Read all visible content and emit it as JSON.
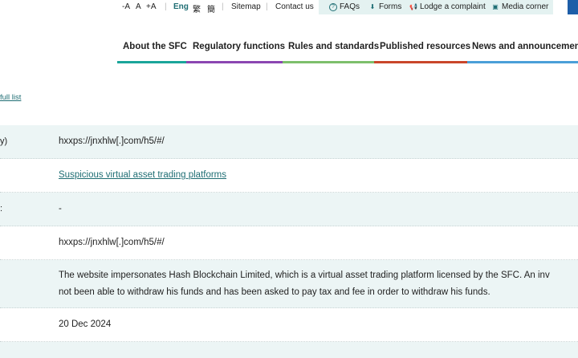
{
  "topbar": {
    "font_sizes": [
      "-A",
      "A",
      "+A"
    ],
    "languages": [
      "Eng",
      "繁",
      "簡"
    ],
    "links": [
      "Sitemap",
      "Contact us"
    ]
  },
  "quick_links": [
    {
      "label": "FAQs",
      "icon": "question-circle-icon"
    },
    {
      "label": "Forms",
      "icon": "download-icon"
    },
    {
      "label": "Lodge a complaint",
      "icon": "megaphone-icon"
    },
    {
      "label": "Media corner",
      "icon": "image-icon"
    }
  ],
  "nav": [
    {
      "label": "About the SFC",
      "color": "#1aa59a"
    },
    {
      "label": "Regulatory functions",
      "color": "#8b46b2"
    },
    {
      "label": "Rules and standards",
      "color": "#7dbf6b"
    },
    {
      "label": "Published resources",
      "color": "#c9462a"
    },
    {
      "label": "News and announcements",
      "color": "#4a9fd8"
    }
  ],
  "back_link": "full list",
  "rows": [
    {
      "label": "y)",
      "value": "hxxps://jnxhlw[.]com/h5/#/"
    },
    {
      "label": "",
      "value": "Suspicious virtual asset trading platforms",
      "link": true
    },
    {
      "label": ":",
      "value": "-"
    },
    {
      "label": "",
      "value": "hxxps://jnxhlw[.]com/h5/#/"
    },
    {
      "label": "",
      "value_line1": "The website impersonates Hash Blockchain Limited, which is a virtual asset trading platform licensed by the SFC. An inv",
      "value_line2": "not been able to withdraw his funds and has been asked to pay tax and fee in order to withdraw his funds."
    },
    {
      "label": "",
      "value": "20 Dec 2024"
    },
    {
      "label": "",
      "value": ""
    }
  ],
  "colors": {
    "accent": "#1f6e74",
    "row_alt": "#ecf5f5",
    "quick_bg": "#e4f2f1"
  }
}
